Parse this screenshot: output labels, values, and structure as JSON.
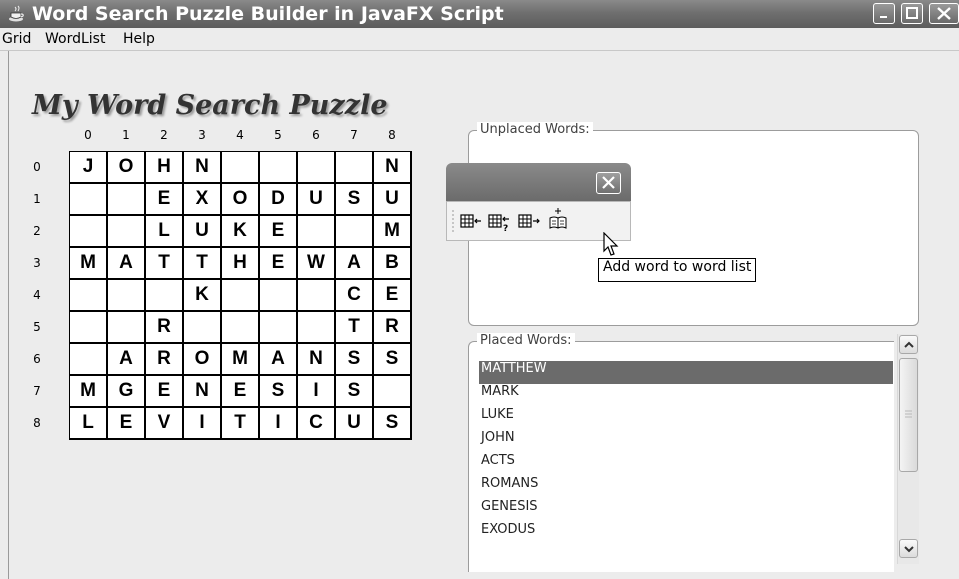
{
  "window": {
    "title": "Word Search Puzzle Builder in JavaFX Script"
  },
  "menu": {
    "items": [
      "Grid",
      "WordList",
      "Help"
    ]
  },
  "puzzle": {
    "title": "My Word Search Puzzle",
    "col_labels": [
      "0",
      "1",
      "2",
      "3",
      "4",
      "5",
      "6",
      "7",
      "8"
    ],
    "row_labels": [
      "0",
      "1",
      "2",
      "3",
      "4",
      "5",
      "6",
      "7",
      "8"
    ],
    "grid": [
      [
        "J",
        "O",
        "H",
        "N",
        "",
        "",
        "",
        "",
        "N"
      ],
      [
        "",
        "",
        "E",
        "X",
        "O",
        "D",
        "U",
        "S",
        "U"
      ],
      [
        "",
        "",
        "L",
        "U",
        "K",
        "E",
        "",
        "",
        "M"
      ],
      [
        "M",
        "A",
        "T",
        "T",
        "H",
        "E",
        "W",
        "A",
        "B"
      ],
      [
        "",
        "",
        "",
        "K",
        "",
        "",
        "",
        "C",
        "E"
      ],
      [
        "",
        "",
        "R",
        "",
        "",
        "",
        "",
        "T",
        "R"
      ],
      [
        "",
        "A",
        "R",
        "O",
        "M",
        "A",
        "N",
        "S",
        "S"
      ],
      [
        "M",
        "G",
        "E",
        "N",
        "E",
        "S",
        "I",
        "S",
        ""
      ],
      [
        "L",
        "E",
        "V",
        "I",
        "T",
        "I",
        "C",
        "U",
        "S"
      ]
    ]
  },
  "unplaced": {
    "legend": "Unplaced Words:"
  },
  "placed": {
    "legend": "Placed Words:",
    "words": [
      "MATTHEW",
      "MARK",
      "LUKE",
      "JOHN",
      "ACTS",
      "ROMANS",
      "GENESIS",
      "EXODUS"
    ],
    "selected": "MATTHEW"
  },
  "toolbar": {
    "buttons": [
      "place-word-icon",
      "place-word-random-icon",
      "unplace-word-icon",
      "add-word-icon"
    ]
  },
  "tooltip": {
    "text": "Add word to word list"
  }
}
